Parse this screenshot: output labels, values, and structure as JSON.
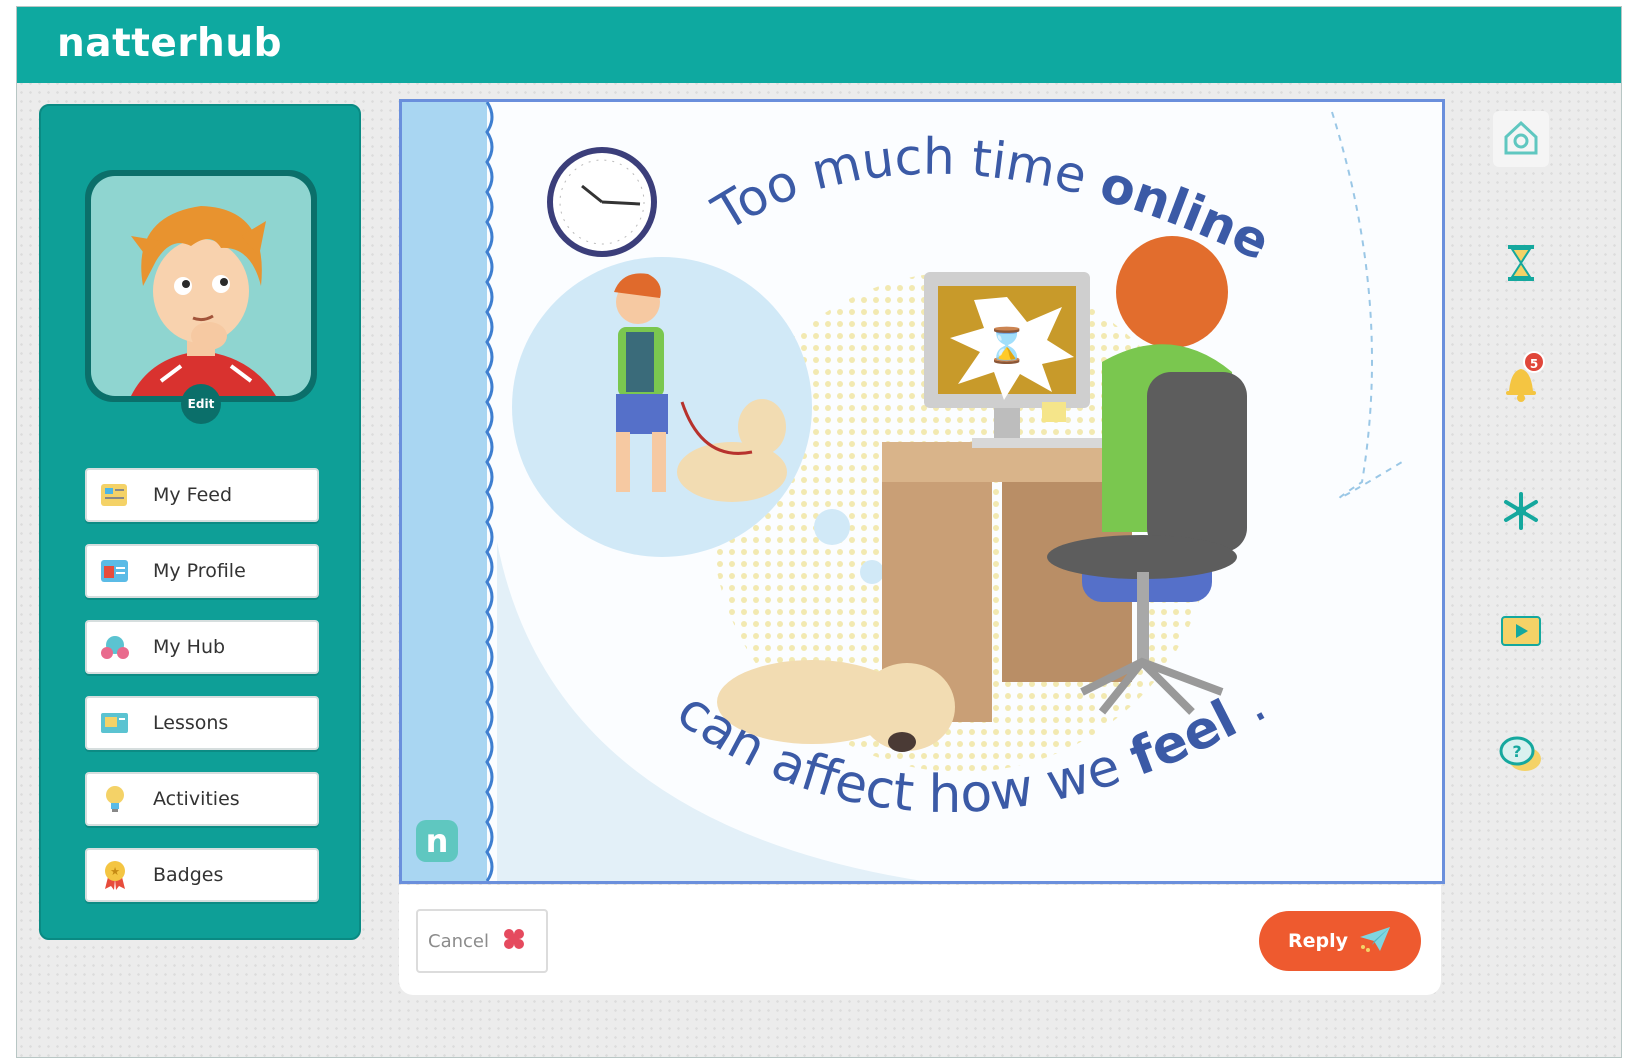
{
  "app": {
    "logo": "natterhub"
  },
  "profile": {
    "edit_label": "Edit"
  },
  "sidebar": {
    "items": [
      {
        "label": "My Feed",
        "icon": "feed-icon"
      },
      {
        "label": "My Profile",
        "icon": "profile-card-icon"
      },
      {
        "label": "My Hub",
        "icon": "hub-icon"
      },
      {
        "label": "Lessons",
        "icon": "lessons-icon"
      },
      {
        "label": "Activities",
        "icon": "lightbulb-icon"
      },
      {
        "label": "Badges",
        "icon": "badge-icon"
      }
    ]
  },
  "poster": {
    "line1": "Too much time",
    "line1_bold": "online",
    "line2": "can affect how we",
    "line2_bold": "feel",
    "corner_logo": "n"
  },
  "actions": {
    "cancel_label": "Cancel",
    "reply_label": "Reply"
  },
  "rightbar": {
    "icons": [
      "home-icon",
      "hourglass-icon",
      "bell-icon",
      "snowflake-icon",
      "video-icon",
      "help-chat-icon"
    ],
    "notification_count": "5"
  },
  "colors": {
    "brand": "#0ea9a0",
    "sidebar": "#0e9f97",
    "reply": "#ee5a2f",
    "poster_text": "#3b5aa6"
  }
}
